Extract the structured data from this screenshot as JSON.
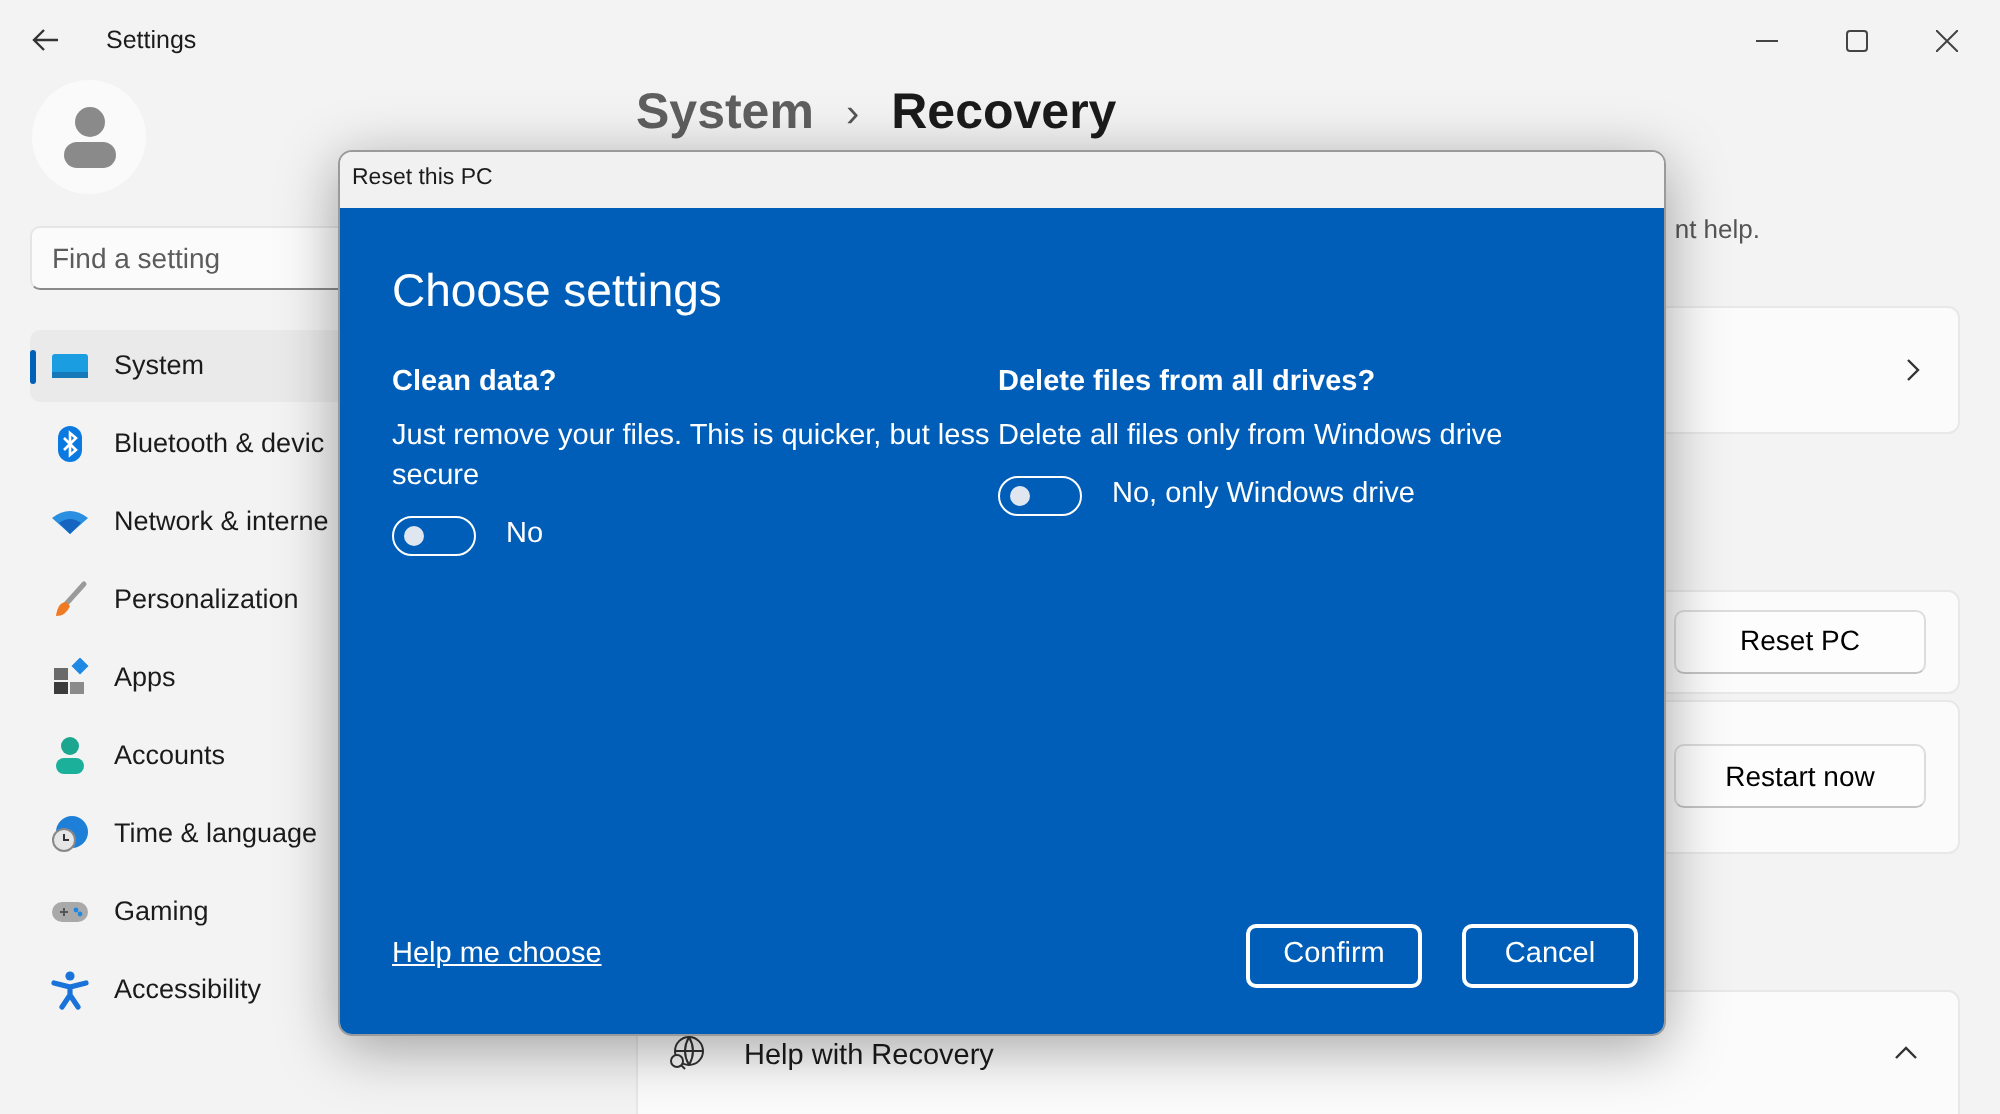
{
  "window": {
    "title": "Settings"
  },
  "sidebar": {
    "search": {
      "placeholder": "Find a setting"
    },
    "items": [
      {
        "label": "System",
        "selected": true
      },
      {
        "label": "Bluetooth & devic",
        "selected": false
      },
      {
        "label": "Network & interne",
        "selected": false
      },
      {
        "label": "Personalization",
        "selected": false
      },
      {
        "label": "Apps",
        "selected": false
      },
      {
        "label": "Accounts",
        "selected": false
      },
      {
        "label": "Time & language",
        "selected": false
      },
      {
        "label": "Gaming",
        "selected": false
      },
      {
        "label": "Accessibility",
        "selected": false
      }
    ]
  },
  "header": {
    "breadcrumb": [
      "System",
      "Recovery"
    ],
    "separator": "›"
  },
  "description_fragment": "nt help.",
  "cards": [
    {
      "kind": "link"
    },
    {
      "kind": "button",
      "button": "Reset PC"
    },
    {
      "kind": "button",
      "button": "Restart now"
    },
    {
      "kind": "expander",
      "label": "Help with Recovery",
      "expanded": true
    }
  ],
  "dialog": {
    "title": "Reset this PC",
    "heading": "Choose settings",
    "options": [
      {
        "title": "Clean data?",
        "description": "Just remove your files. This is quicker, but less secure",
        "toggle": {
          "on": false,
          "label": "No"
        }
      },
      {
        "title": "Delete files from all drives?",
        "description": "Delete all files only from Windows drive",
        "toggle": {
          "on": false,
          "label": "No, only Windows drive"
        }
      }
    ],
    "help_link": "Help me choose",
    "buttons": [
      "Confirm",
      "Cancel"
    ]
  }
}
